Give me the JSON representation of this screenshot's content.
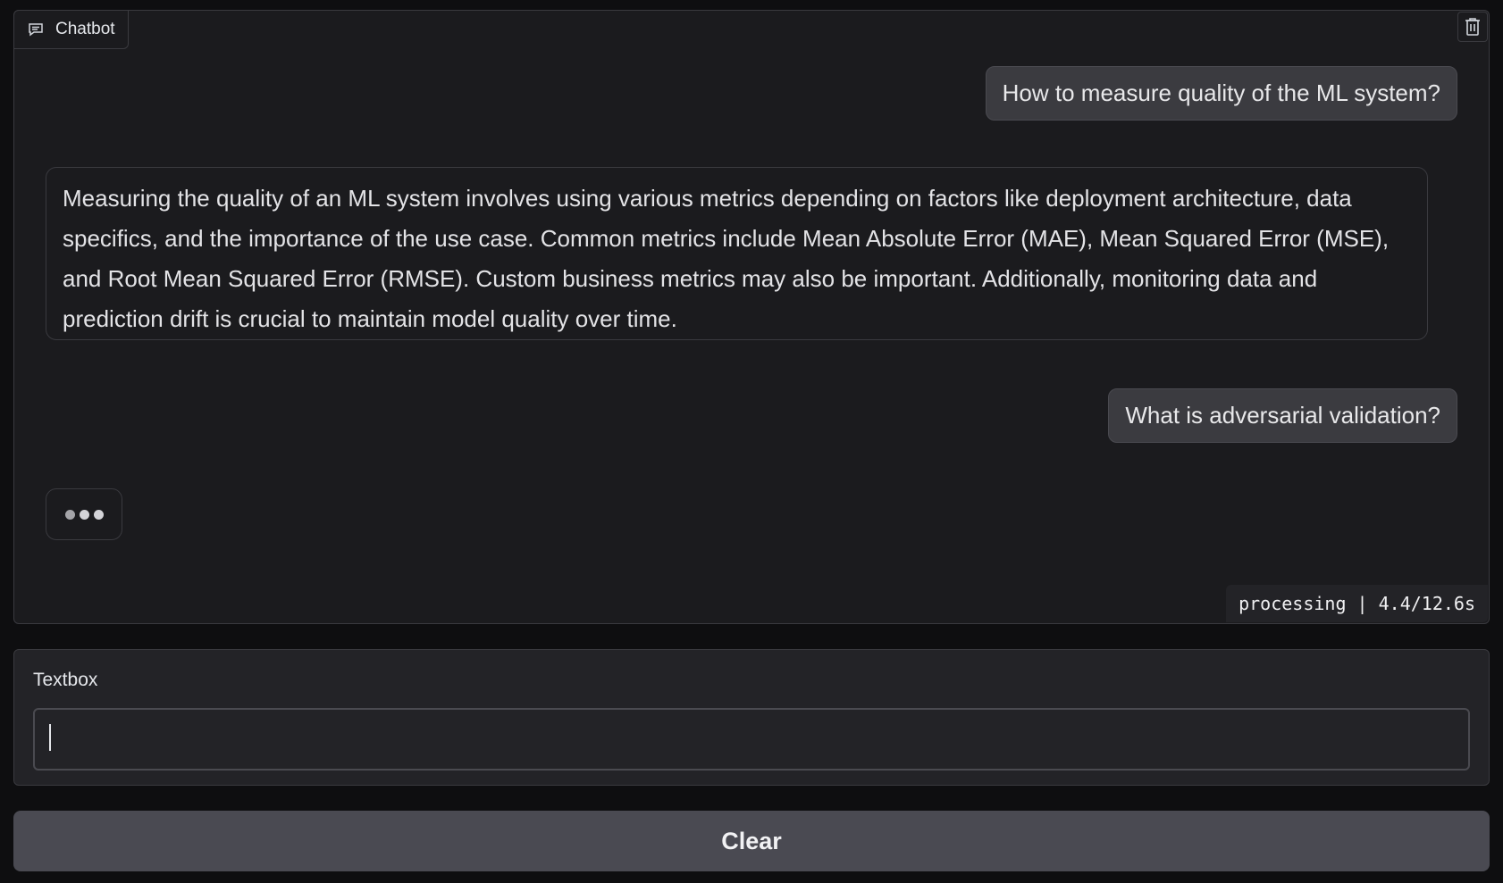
{
  "chatbot": {
    "label": "Chatbot",
    "label_icon": "chat-bubble-icon",
    "clear_icon": "trash-icon",
    "messages": [
      {
        "role": "user",
        "text": "How to measure quality of the ML system?"
      },
      {
        "role": "bot",
        "text": "Measuring the quality of an ML system involves using various metrics depending on factors like deployment architecture, data specifics, and the importance of the use case. Common metrics include Mean Absolute Error (MAE), Mean Squared Error (MSE), and Root Mean Squared Error (RMSE). Custom business metrics may also be important. Additionally, monitoring data and prediction drift is crucial to maintain model quality over time."
      },
      {
        "role": "user",
        "text": "What is adversarial validation?"
      }
    ],
    "typing_indicator": "typing-dots",
    "status": "processing | 4.4/12.6s"
  },
  "textbox": {
    "label": "Textbox",
    "value": "",
    "placeholder": ""
  },
  "clear_button": {
    "label": "Clear"
  },
  "colors": {
    "background": "#0e0e10",
    "panel": "#1b1b1e",
    "user_bubble": "#3b3b40",
    "button": "#4a4a52"
  }
}
